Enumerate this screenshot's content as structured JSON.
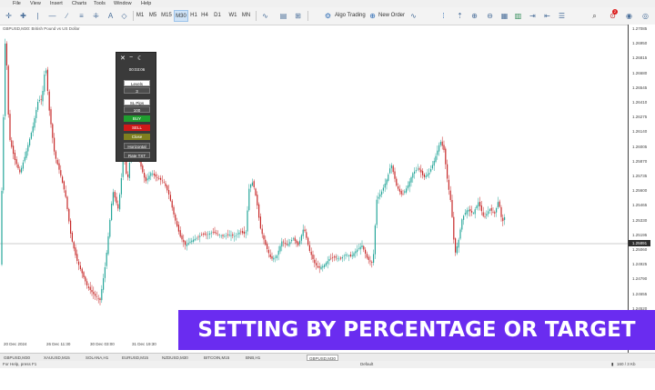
{
  "menu": [
    "File",
    "View",
    "Insert",
    "Charts",
    "Tools",
    "Window",
    "Help"
  ],
  "toolbar": {
    "timeframes": [
      "M1",
      "M5",
      "M15",
      "M30",
      "H1",
      "H4",
      "D1",
      "W1",
      "MN"
    ],
    "selected_timeframe": "M30",
    "algo_trading": "Algo Trading",
    "new_order": "New Order",
    "notification_count": "2"
  },
  "chart": {
    "title": "GBPUSD,M30: British Pound vs US Dollar",
    "current_price": "1.25891",
    "price_labels": [
      "1.27085",
      "1.26950",
      "1.26815",
      "1.26680",
      "1.26545",
      "1.26410",
      "1.26275",
      "1.26140",
      "1.26005",
      "1.25870",
      "1.25735",
      "1.25600",
      "1.25465",
      "1.25330",
      "1.25195",
      "1.25060",
      "1.24925",
      "1.24790",
      "1.24655",
      "1.24520",
      "1.24385"
    ],
    "time_labels": [
      "20 Dec 2024",
      "26 Dec 11:30",
      "30 Dec 03:00",
      "31 Dec 19:30"
    ]
  },
  "panel": {
    "clock": "00:03:06",
    "levels_label": "Levels",
    "levels_value": "3",
    "sl_pips_label": "SL Pips",
    "sl_pips_value": "100",
    "buy": "BUY",
    "sell": "SELL",
    "close": "Close",
    "horizontal": "Horizontal",
    "rate": "Rate TXT"
  },
  "banner": "SETTING BY PERCENTAGE OR TARGET LEVELS",
  "tabs": [
    "GBPUSD,M30",
    "XAUUSD,M15",
    "SOLANA,H1",
    "EURUSD,M15",
    "NZDUSD,M30",
    "BITCOIN,M15",
    "BNB,H1",
    "GBPUSD,M30"
  ],
  "active_tab_index": 7,
  "status": {
    "help": "For Help, press F1",
    "profile": "Default",
    "traffic": "160 / 3 Kb"
  },
  "colors": {
    "bull": "#26a69a",
    "bear": "#c62828",
    "banner": "#6a2cf0"
  }
}
